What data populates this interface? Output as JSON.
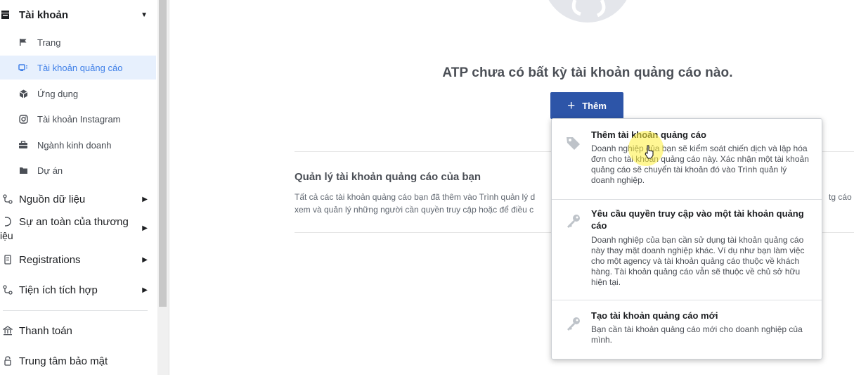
{
  "sidebar": {
    "account_section": {
      "label": "Tài khoản"
    },
    "sub_items": [
      {
        "label": "Trang",
        "icon": "flag-icon"
      },
      {
        "label": "Tài khoản quảng cáo",
        "icon": "ad-account-icon",
        "active": true
      },
      {
        "label": "Ứng dụng",
        "icon": "cube-icon"
      },
      {
        "label": "Tài khoản Instagram",
        "icon": "instagram-icon"
      },
      {
        "label": "Ngành kinh doanh",
        "icon": "briefcase-icon"
      },
      {
        "label": "Dự án",
        "icon": "folder-icon"
      }
    ],
    "sections": [
      {
        "label": "Nguồn dữ liệu",
        "icon": "data-sources-icon"
      },
      {
        "label_line1": "Sự an toàn của thương",
        "label_line2": "iệu",
        "icon": "brand-safety-icon"
      },
      {
        "label": "Registrations",
        "icon": "registrations-icon"
      },
      {
        "label": "Tiện ích tích hợp",
        "icon": "integrations-icon"
      }
    ],
    "bottom_items": [
      {
        "label": "Thanh toán",
        "icon": "bank-icon"
      },
      {
        "label": "Trung tâm bảo mật",
        "icon": "lock-icon"
      }
    ]
  },
  "main": {
    "empty_title": "ATP chưa có bất kỳ tài khoản quảng cáo nào.",
    "add_button": "Thêm",
    "manage_title": "Quản lý tài khoản quảng cáo của bạn",
    "manage_desc_line1": "Tất cả các tài khoản quảng cáo bạn đã thêm vào Trình quản lý d",
    "manage_desc_line2": "xem và quản lý những người cần quyền truy cập hoặc để điều c",
    "manage_desc_right": "tg cáo r"
  },
  "dropdown": {
    "items": [
      {
        "title": "Thêm tài khoản quảng cáo",
        "desc": "Doanh nghiệp của bạn sẽ kiểm soát chiến dịch và lập hóa đơn cho tài khoản quảng cáo này. Xác nhận một tài khoản quảng cáo sẽ chuyển tài khoản đó vào Trình quản lý doanh nghiệp.",
        "icon": "tag-icon"
      },
      {
        "title": "Yêu cầu quyền truy cập vào một tài khoản quảng cáo",
        "desc": "Doanh nghiệp của bạn cần sử dụng tài khoản quảng cáo này thay mặt doanh nghiệp khác. Ví dụ như bạn làm việc cho một agency và tài khoản quảng cáo thuộc về khách hàng. Tài khoản quảng cáo vẫn sẽ thuộc về chủ sở hữu hiện tại.",
        "icon": "key-icon"
      },
      {
        "title": "Tạo tài khoản quảng cáo mới",
        "desc": "Bạn cần tài khoản quảng cáo mới cho doanh nghiệp của mình.",
        "icon": "key-icon"
      }
    ]
  },
  "colors": {
    "primary_button": "#2d55a8",
    "active_bg": "#e7f0fd",
    "active_text": "#4080e8",
    "cursor_highlight": "#fff03c"
  }
}
